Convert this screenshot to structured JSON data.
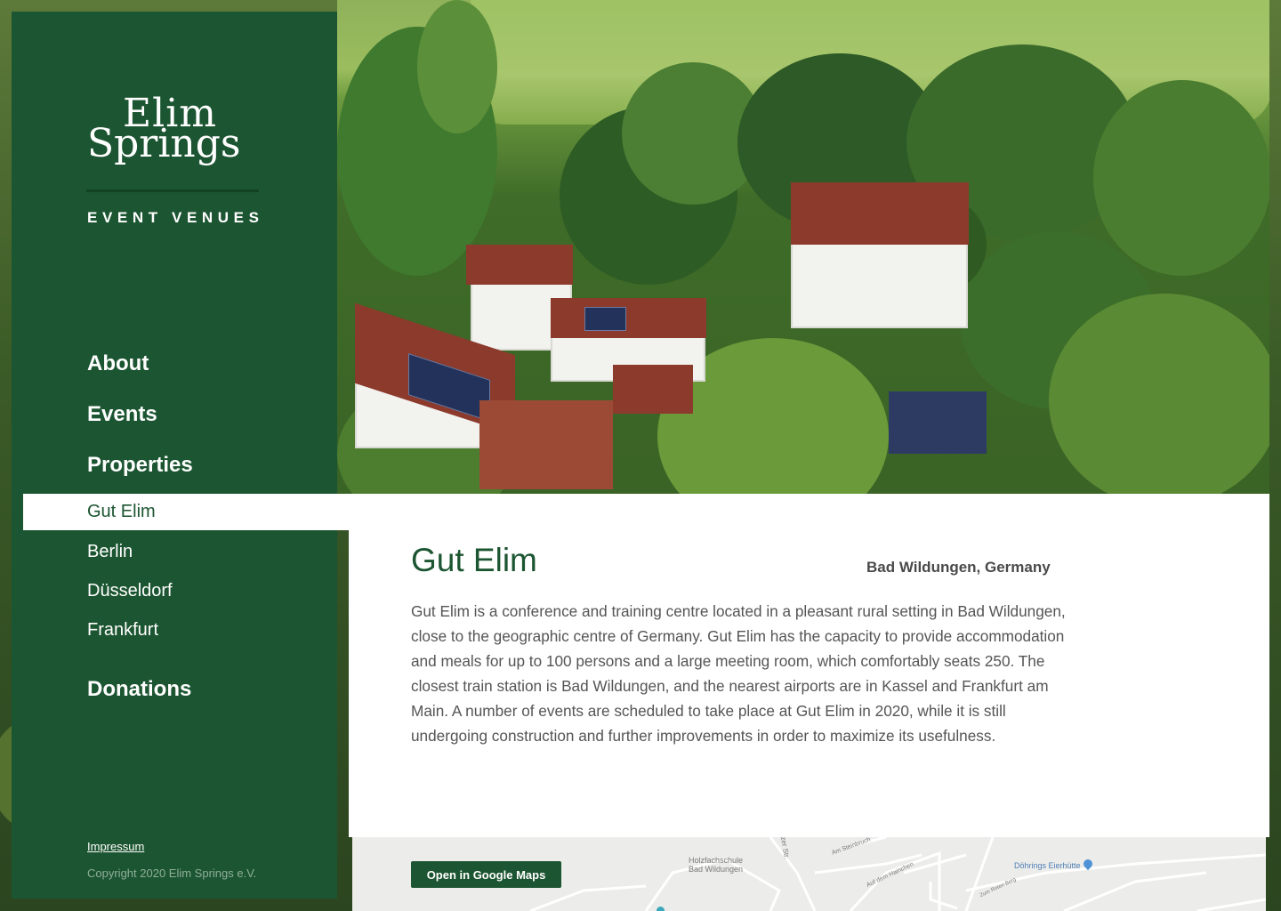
{
  "brand": {
    "line1": "Elim",
    "line2": "Springs",
    "tagline": "EVENT VENUES"
  },
  "nav": {
    "about": "About",
    "events": "Events",
    "properties": "Properties",
    "property_items": [
      "Gut Elim",
      "Berlin",
      "Düsseldorf",
      "Frankfurt"
    ],
    "active_item": "Gut Elim",
    "donations": "Donations"
  },
  "footer": {
    "impressum": "Impressum",
    "copyright": "Copyright 2020 Elim Springs e.V."
  },
  "property": {
    "title": "Gut Elim",
    "location": "Bad Wildungen, Germany",
    "description": "Gut Elim is a conference and training centre located in a pleasant rural setting in Bad Wildungen, close to the geographic centre of Germany. Gut Elim has the capacity to provide accommodation and meals for up to 100 persons and a large meeting room, which comfortably seats 250. The closest train station is Bad Wildungen, and the nearest airports are in Kassel and Frankfurt am Main. A number of events are scheduled to take place at Gut Elim in 2020, while it is still undergoing construction and further improvements in order to maximize its usefulness."
  },
  "map": {
    "button_label": "Open in Google Maps",
    "labels": {
      "holzfachschule": "Holzfachschule",
      "bad_wildungen": "Bad Wildungen",
      "street_1": "tzer Str.",
      "street_2": "Am Steinbruch",
      "street_3": "Auf dem Hainchen",
      "street_4": "Zum Roten Berg",
      "poi": "Döhrings Eierhütte"
    }
  },
  "colors": {
    "brand_green": "#1c5531",
    "white": "#ffffff"
  }
}
